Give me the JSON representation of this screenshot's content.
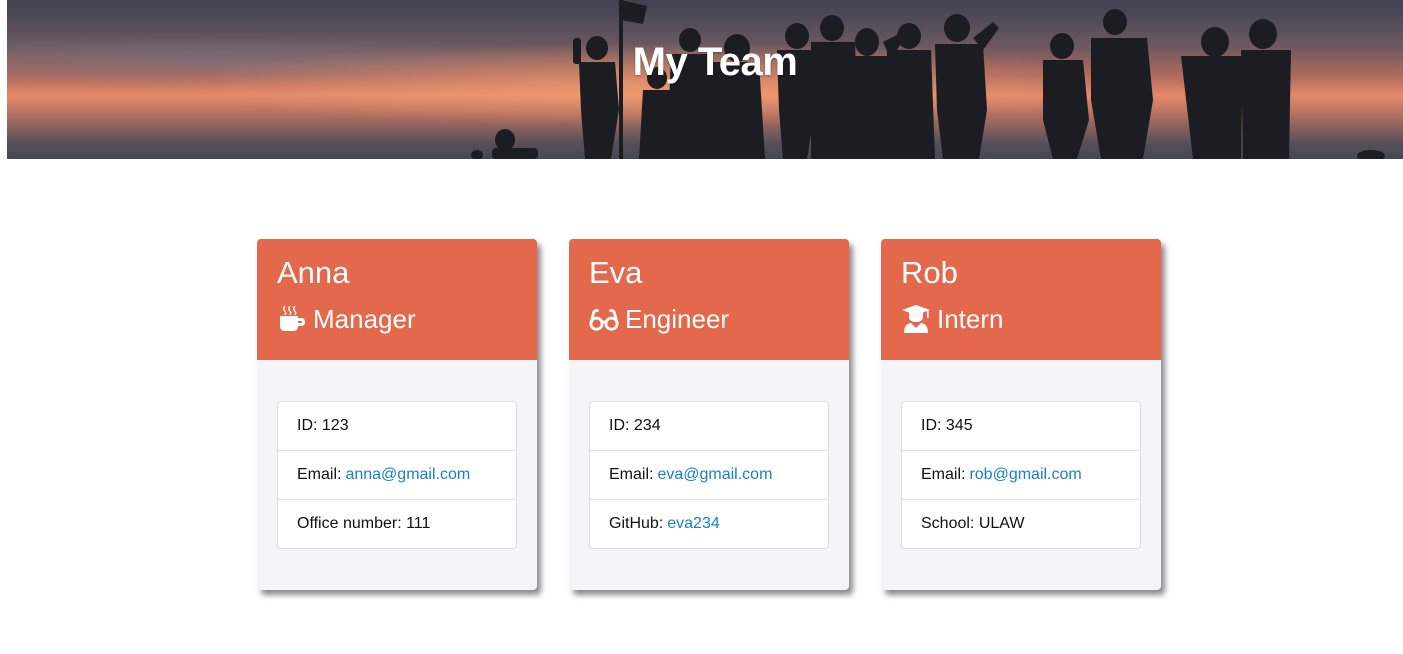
{
  "header": {
    "title": "My Team"
  },
  "team": [
    {
      "name": "Anna",
      "role": "Manager",
      "role_icon": "coffee-icon",
      "id_label": "ID:",
      "id": "123",
      "email_label": "Email:",
      "email": "anna@gmail.com",
      "extra_label": "Office number:",
      "extra_value": "111"
    },
    {
      "name": "Eva",
      "role": "Engineer",
      "role_icon": "glasses-icon",
      "id_label": "ID:",
      "id": "234",
      "email_label": "Email:",
      "email": "eva@gmail.com",
      "extra_label": "GitHub:",
      "extra_value": "eva234"
    },
    {
      "name": "Rob",
      "role": "Intern",
      "role_icon": "graduate-icon",
      "id_label": "ID:",
      "id": "345",
      "email_label": "Email:",
      "email": "rob@gmail.com",
      "extra_label": "School:",
      "extra_value": "ULAW"
    }
  ],
  "colors": {
    "card_header": "#e3684c",
    "card_body": "#f4f5f7",
    "link": "#1a7fc4"
  }
}
